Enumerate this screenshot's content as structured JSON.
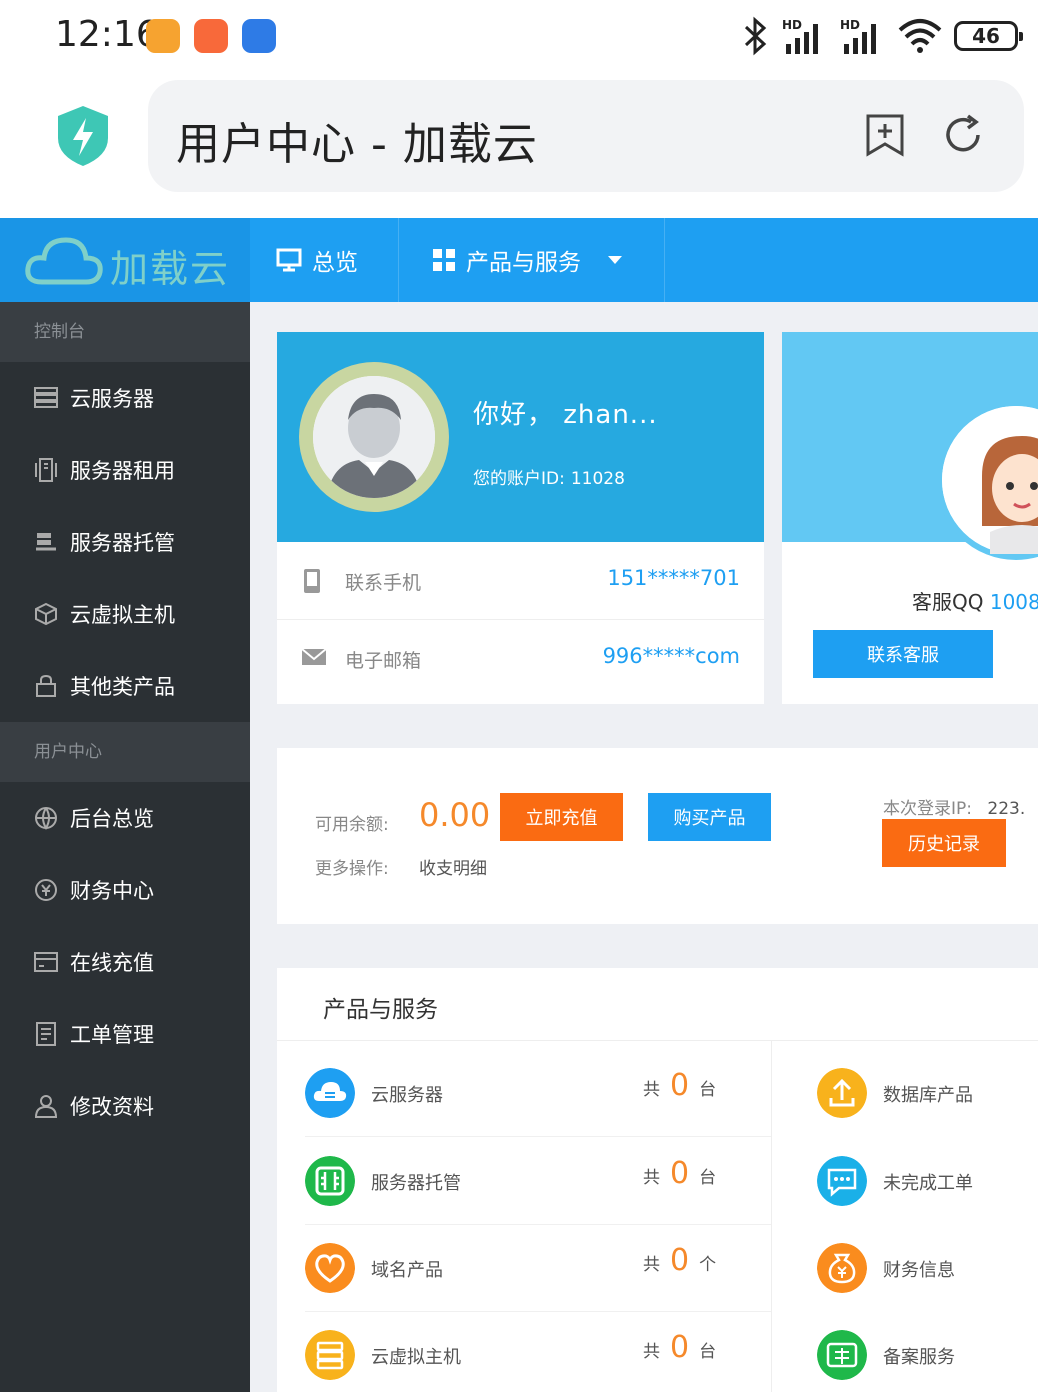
{
  "status_bar": {
    "time": "12:16",
    "battery": "46",
    "signal1": "HD",
    "signal2": "HD"
  },
  "browser": {
    "title": "用户中心 - 加载云"
  },
  "nav": {
    "brand": "加载云",
    "items": [
      {
        "label": "总览"
      },
      {
        "label": "产品与服务"
      }
    ]
  },
  "sidebar": {
    "group1": "控制台",
    "items1": [
      "云服务器",
      "服务器租用",
      "服务器托管",
      "云虚拟主机",
      "其他类产品"
    ],
    "group2": "用户中心",
    "items2": [
      "后台总览",
      "财务中心",
      "在线充值",
      "工单管理",
      "修改资料"
    ]
  },
  "user": {
    "greeting": "你好， zhan...",
    "account_label": "您的账户ID:",
    "account_id": "11028",
    "phone_label": "联系手机",
    "phone_value": "151*****701",
    "email_label": "电子邮箱",
    "email_value": "996*****com"
  },
  "service": {
    "qq_label": "客服QQ",
    "qq_value": "1008",
    "contact_button": "联系客服"
  },
  "balance": {
    "label": "可用余额:",
    "value": "0.00",
    "recharge_button": "立即充值",
    "buy_button": "购买产品",
    "more_label": "更多操作:",
    "more_link": "收支明细",
    "ip_label": "本次登录IP:",
    "ip_value": "223.",
    "history_button": "历史记录"
  },
  "products": {
    "title": "产品与服务",
    "left": [
      {
        "name": "云服务器",
        "prefix": "共",
        "count": "0",
        "unit": "台"
      },
      {
        "name": "服务器托管",
        "prefix": "共",
        "count": "0",
        "unit": "台"
      },
      {
        "name": "域名产品",
        "prefix": "共",
        "count": "0",
        "unit": "个"
      },
      {
        "name": "云虚拟主机",
        "prefix": "共",
        "count": "0",
        "unit": "台"
      }
    ],
    "right": [
      "数据库产品",
      "未完成工单",
      "财务信息",
      "备案服务"
    ]
  },
  "colors": {
    "nav_blue": "#1e9ff2",
    "sidebar": "#2b3034",
    "orange": "#f5892b",
    "user_blue": "#26a9e0"
  }
}
